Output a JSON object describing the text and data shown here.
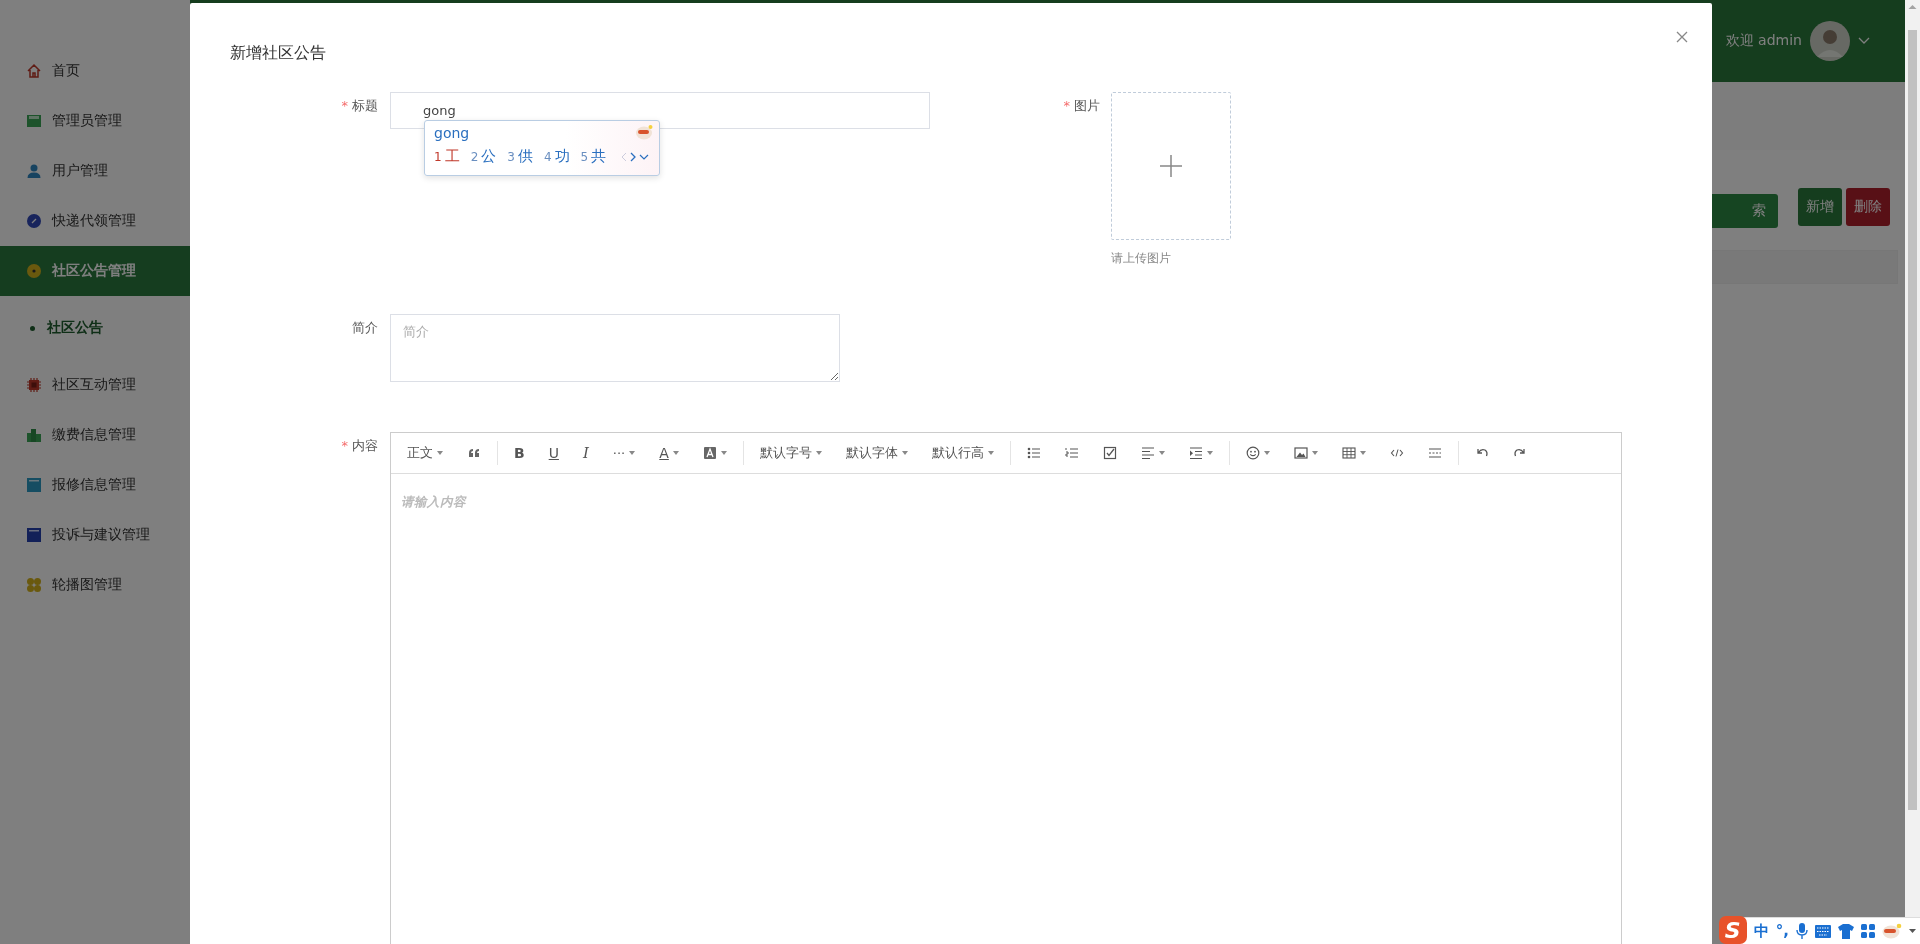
{
  "sidebar": {
    "items": [
      {
        "label": "首页",
        "selected": false
      },
      {
        "label": "管理员管理",
        "selected": false
      },
      {
        "label": "用户管理",
        "selected": false
      },
      {
        "label": "快递代领管理",
        "selected": false
      },
      {
        "label": "社区公告管理",
        "selected": true,
        "children": [
          {
            "label": "社区公告",
            "selected": true
          }
        ]
      },
      {
        "label": "社区互动管理",
        "selected": false
      },
      {
        "label": "缴费信息管理",
        "selected": false
      },
      {
        "label": "报修信息管理",
        "selected": false
      },
      {
        "label": "投诉与建议管理",
        "selected": false
      },
      {
        "label": "轮播图管理",
        "selected": false
      }
    ]
  },
  "header": {
    "welcome": "欢迎 admin"
  },
  "page_buttons": [
    {
      "label": "索",
      "kind": "search"
    },
    {
      "label": "新增",
      "kind": "add"
    },
    {
      "label": "删除",
      "kind": "delete"
    }
  ],
  "dialog": {
    "title": "新增社区公告",
    "title_field": {
      "marker": "*",
      "label": "标题",
      "value": "gong"
    },
    "ime_popup": {
      "composition": "gong",
      "candidates": [
        {
          "index": "1",
          "text": "工",
          "selected": true
        },
        {
          "index": "2",
          "text": "公",
          "selected": false
        },
        {
          "index": "3",
          "text": "供",
          "selected": false
        },
        {
          "index": "4",
          "text": "功",
          "selected": false
        },
        {
          "index": "5",
          "text": "共",
          "selected": false
        }
      ]
    },
    "image_field": {
      "marker": "*",
      "label": "图片",
      "hint": "请上传图片"
    },
    "intro_field": {
      "label": "简介",
      "placeholder": "简介"
    },
    "content_field": {
      "marker": "*",
      "label": "内容",
      "placeholder": "请输入内容",
      "toolbar": [
        [
          {
            "kind": "text",
            "label": "正文",
            "dropdown": true
          },
          {
            "kind": "quote",
            "dropdown": false
          }
        ],
        [
          {
            "kind": "bold",
            "label": "B",
            "dropdown": false
          },
          {
            "kind": "underline",
            "label": "U",
            "dropdown": false
          },
          {
            "kind": "italic",
            "label": "I",
            "dropdown": false
          },
          {
            "kind": "text",
            "label": "···",
            "dropdown": true
          },
          {
            "kind": "underline",
            "label": "A",
            "dropdown": true
          },
          {
            "kind": "highlight",
            "dropdown": true
          }
        ],
        [
          {
            "kind": "text",
            "label": "默认字号",
            "dropdown": true
          },
          {
            "kind": "text",
            "label": "默认字体",
            "dropdown": true
          },
          {
            "kind": "text",
            "label": "默认行高",
            "dropdown": true
          }
        ],
        [
          {
            "kind": "bullets",
            "dropdown": false
          },
          {
            "kind": "numbers",
            "dropdown": false
          },
          {
            "kind": "todo",
            "dropdown": false
          },
          {
            "kind": "align",
            "dropdown": true
          },
          {
            "kind": "indent",
            "dropdown": true
          }
        ],
        [
          {
            "kind": "emoji",
            "dropdown": true
          },
          {
            "kind": "image",
            "dropdown": true
          },
          {
            "kind": "table",
            "dropdown": true
          },
          {
            "kind": "code",
            "dropdown": false
          },
          {
            "kind": "divider",
            "dropdown": false
          }
        ],
        [
          {
            "kind": "undo",
            "dropdown": false
          },
          {
            "kind": "redo",
            "dropdown": false
          }
        ]
      ]
    }
  },
  "ime_tray": {
    "logo": "S",
    "mode": "中",
    "punctuation": "°,"
  }
}
